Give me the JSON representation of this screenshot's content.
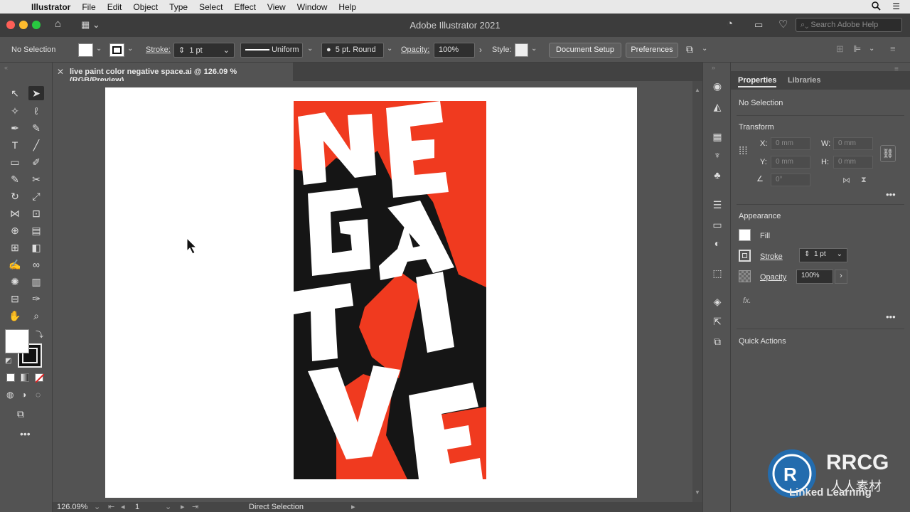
{
  "menubar": {
    "apple_icon": "apple-icon",
    "items": [
      "Illustrator",
      "File",
      "Edit",
      "Object",
      "Type",
      "Select",
      "Effect",
      "View",
      "Window",
      "Help"
    ]
  },
  "window": {
    "title": "Adobe Illustrator 2021",
    "search_placeholder": "Search Adobe Help"
  },
  "control_bar": {
    "selection_label": "No Selection",
    "stroke_label": "Stroke:",
    "stroke_weight": "1 pt",
    "stroke_profile": "Uniform",
    "brush": "5 pt. Round",
    "opacity_label": "Opacity:",
    "opacity_value": "100%",
    "style_label": "Style:",
    "document_setup": "Document Setup",
    "preferences": "Preferences"
  },
  "document_tab": {
    "title": "live paint color negative space.ai @ 126.09 % (RGB/Preview)"
  },
  "status_bar": {
    "zoom": "126.09%",
    "artboard": "1",
    "tool": "Direct Selection"
  },
  "properties_panel": {
    "tabs": [
      "Properties",
      "Libraries"
    ],
    "selection": "No Selection",
    "transform_title": "Transform",
    "x_label": "X:",
    "y_label": "Y:",
    "w_label": "W:",
    "h_label": "H:",
    "x_value": "0 mm",
    "y_value": "0 mm",
    "w_value": "0 mm",
    "h_value": "0 mm",
    "angle_value": "0°",
    "appearance_title": "Appearance",
    "fill_label": "Fill",
    "stroke_label": "Stroke",
    "stroke_value": "1 pt",
    "opacity_label": "Opacity",
    "opacity_value": "100%",
    "fx_label": "fx.",
    "quick_actions_title": "Quick Actions"
  },
  "artwork": {
    "letters": [
      "N",
      "E",
      "G",
      "A",
      "T",
      "I",
      "V",
      "E"
    ],
    "colors": {
      "red": "#f03a1f",
      "black": "#151515",
      "white": "#ffffff"
    }
  },
  "watermark": {
    "brand": "RRCG",
    "brand_cn": "人人素材",
    "sub": "Linked Learning"
  }
}
